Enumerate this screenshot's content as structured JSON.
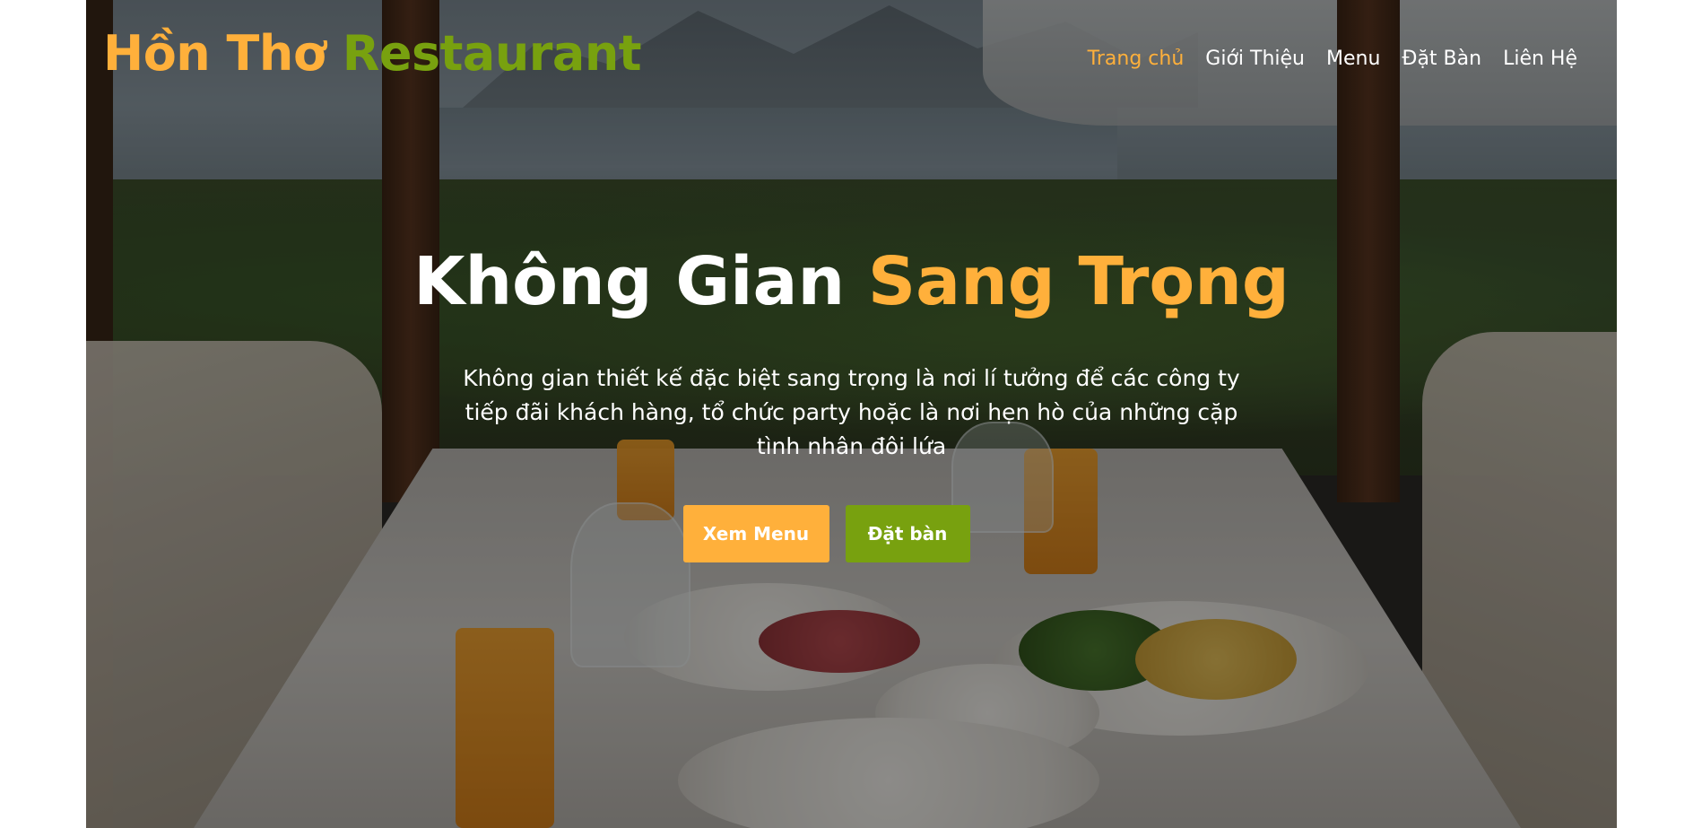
{
  "brand": {
    "name_part_1": "Hồn Thơ",
    "name_part_2": "Restaurant",
    "colors": {
      "primary": "#ffb03b",
      "secondary": "#78a10f",
      "text": "#ffffff"
    }
  },
  "nav": {
    "items": [
      {
        "label": "Trang chủ",
        "active": true
      },
      {
        "label": "Giới Thiệu",
        "active": false
      },
      {
        "label": "Menu",
        "active": false
      },
      {
        "label": "Đặt Bàn",
        "active": false
      },
      {
        "label": "Liên Hệ",
        "active": false
      }
    ]
  },
  "hero": {
    "title_plain": "Không Gian",
    "title_accent": "Sang Trọng",
    "description": "Không gian thiết kế đặc biệt sang trọng là nơi lí tưởng để các công ty tiếp đãi khách hàng, tổ chức party hoặc là nơi hẹn hò của những cặp tình nhân đôi lứa",
    "buttons": {
      "menu_label": "Xem Menu",
      "book_label": "Đặt bàn"
    },
    "background_image": "restaurant-table-by-marina-window"
  }
}
